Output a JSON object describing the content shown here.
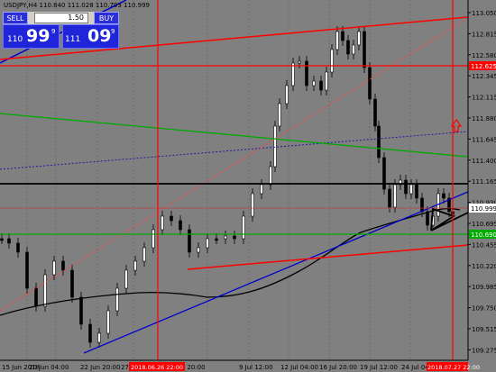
{
  "symbol_info": "USDJPY,H4  110.840 111.028 110.793 110.999",
  "trade_panel": {
    "sell_label": "SELL",
    "buy_label": "BUY",
    "lot_value": "1.50",
    "sell_prefix": "110",
    "sell_big": "99",
    "sell_sup": "9",
    "buy_prefix": "111",
    "buy_big": "09",
    "buy_sup": "9"
  },
  "price_axis": [
    "113.050",
    "112.815",
    "112.580",
    "112.345",
    "112.115",
    "111.880",
    "111.645",
    "111.400",
    "111.165",
    "110.930",
    "110.695",
    "110.455",
    "110.220",
    "109.985",
    "109.750",
    "109.515",
    "109.275"
  ],
  "price_tags": {
    "resistance": "112.625",
    "current": "110.999",
    "support": "110.690"
  },
  "time_axis": [
    "15 Jun 2018",
    "20 Jun 04:00",
    "22 Jun 20:00",
    "27 Ju",
    "4 Jul 20:00",
    "9 Jul 12:00",
    "12 Jul 04:00",
    "16 Jul 20:00",
    "19 Jul 12:00",
    "24 Jul 04:00"
  ],
  "time_markers": [
    "2018.06.26 22:00",
    "2018.07.27 22:00"
  ],
  "colors": {
    "background": "#808080",
    "resistance_line": "#ff0000",
    "support_line": "#00aa00",
    "trend_line": "#0000cc",
    "moving_average": "#000000"
  },
  "icons": [
    "up-arrow-icon"
  ]
}
